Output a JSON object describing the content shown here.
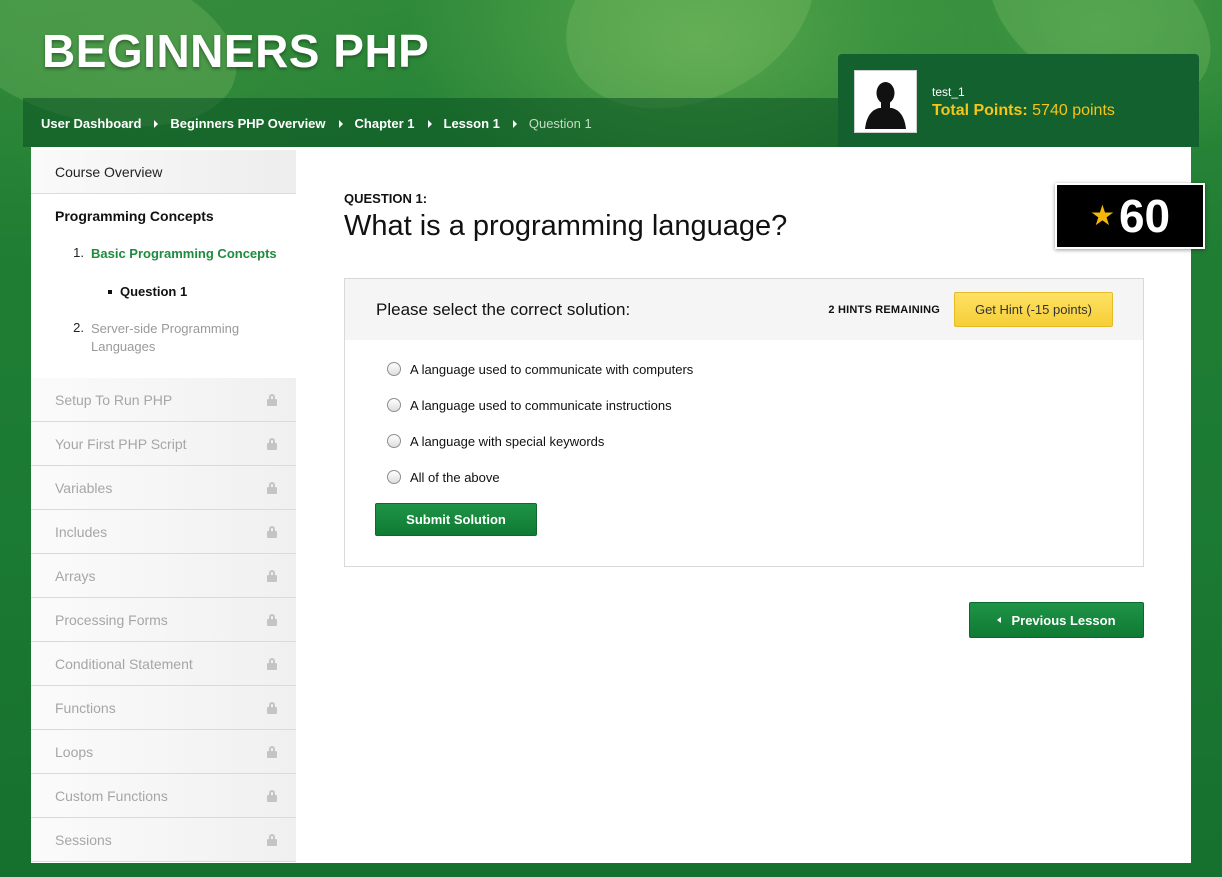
{
  "site": {
    "title": "BEGINNERS PHP"
  },
  "breadcrumb": [
    {
      "label": "User Dashboard"
    },
    {
      "label": "Beginners PHP Overview"
    },
    {
      "label": "Chapter 1"
    },
    {
      "label": "Lesson 1"
    },
    {
      "label": "Question 1"
    }
  ],
  "user": {
    "name": "test_1",
    "points_label": "Total Points:",
    "points_value": "5740 points"
  },
  "sidebar": {
    "overview": "Course Overview",
    "section_title": "Programming Concepts",
    "sub_items": [
      {
        "num": "1.",
        "label": "Basic Programming Concepts"
      },
      {
        "num": "2.",
        "label": "Server-side Programming Languages"
      }
    ],
    "current_question": "Question 1",
    "locked": [
      {
        "label": "Setup To Run PHP"
      },
      {
        "label": "Your First PHP Script"
      },
      {
        "label": "Variables"
      },
      {
        "label": "Includes"
      },
      {
        "label": "Arrays"
      },
      {
        "label": "Processing Forms"
      },
      {
        "label": "Conditional Statement"
      },
      {
        "label": "Functions"
      },
      {
        "label": "Loops"
      },
      {
        "label": "Custom Functions"
      },
      {
        "label": "Sessions"
      }
    ]
  },
  "question": {
    "label": "QUESTION 1:",
    "title": "What is a programming language?",
    "score": "60"
  },
  "panel": {
    "prompt": "Please select the correct solution:",
    "hints_remaining": "2 HINTS REMAINING",
    "hint_button": "Get Hint (-15 points)",
    "options": [
      {
        "label": "A language used to communicate with computers"
      },
      {
        "label": "A language used to communicate instructions"
      },
      {
        "label": "A language with special keywords"
      },
      {
        "label": "All of the above"
      }
    ],
    "submit": "Submit Solution"
  },
  "nav": {
    "previous": "Previous Lesson"
  },
  "colors": {
    "brand_green": "#1b7a33",
    "accent_yellow": "#f5c518",
    "button_green": "#0f7a33"
  }
}
